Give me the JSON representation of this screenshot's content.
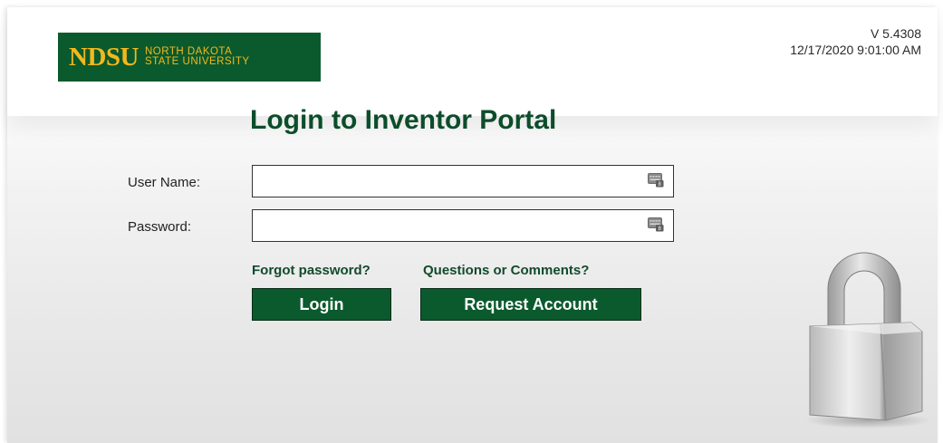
{
  "header": {
    "logo_main": "NDSU",
    "logo_line1": "NORTH DAKOTA",
    "logo_line2": "STATE UNIVERSITY",
    "version": "V 5.4308",
    "datetime": "12/17/2020 9:01:00 AM"
  },
  "login": {
    "title": "Login to Inventor Portal",
    "username_label": "User Name:",
    "username_value": "",
    "password_label": "Password:",
    "password_value": "",
    "forgot_link": "Forgot password?",
    "questions_link": "Questions or Comments?",
    "login_button": "Login",
    "request_button": "Request Account"
  },
  "icons": {
    "keyboard": "virtual-keyboard-icon",
    "lock": "padlock-icon"
  },
  "colors": {
    "brand_green": "#0b5a2d",
    "brand_gold": "#f3b81c",
    "title_green": "#0c4d2a"
  }
}
